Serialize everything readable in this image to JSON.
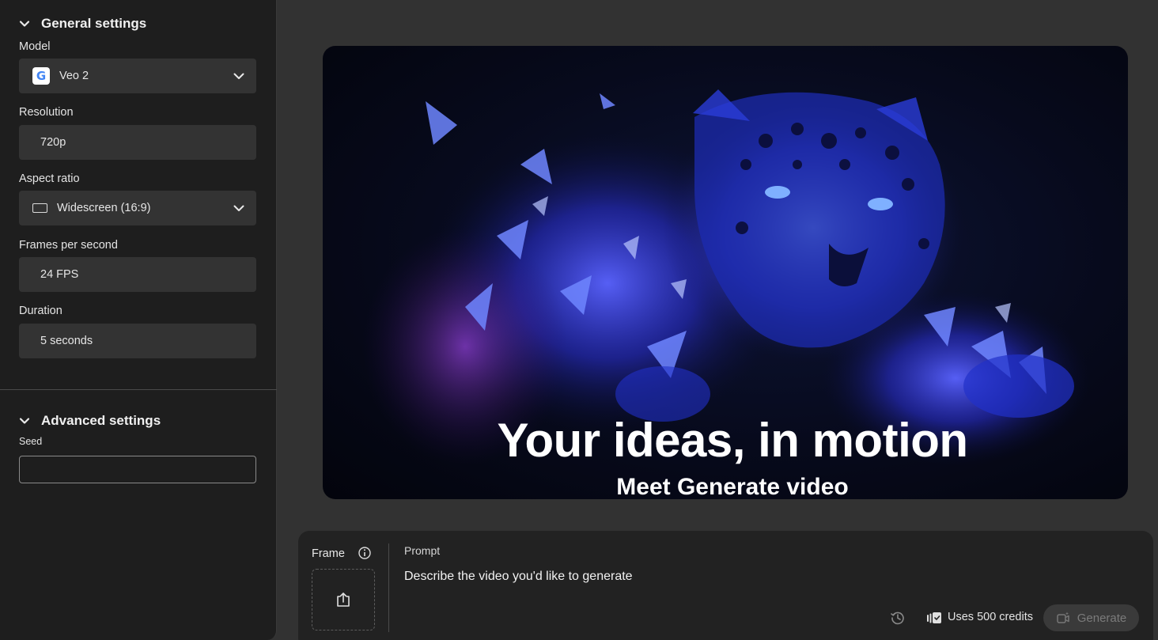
{
  "sidebar": {
    "general_heading": "General settings",
    "model": {
      "label": "Model",
      "value": "Veo 2",
      "logo_letter": "G",
      "icon": "google-logo-icon"
    },
    "resolution": {
      "label": "Resolution",
      "value": "720p"
    },
    "aspect_ratio": {
      "label": "Aspect ratio",
      "value": "Widescreen (16:9)",
      "icon": "widescreen-icon"
    },
    "fps": {
      "label": "Frames per second",
      "value": "24 FPS"
    },
    "duration": {
      "label": "Duration",
      "value": "5 seconds"
    },
    "advanced_heading": "Advanced settings",
    "seed": {
      "label": "Seed",
      "value": ""
    }
  },
  "hero": {
    "title": "Your ideas, in motion",
    "subtitle": "Meet Generate video",
    "image": "glowing blue crystalline jaguar leaping"
  },
  "prompt_panel": {
    "frame_label": "Frame",
    "prompt_label": "Prompt",
    "prompt_placeholder": "Describe the video you'd like to generate",
    "credits_text": "Uses 500 credits",
    "generate_label": "Generate"
  },
  "colors": {
    "page_bg": "#323232",
    "sidebar_bg": "#1e1e1e",
    "field_bg": "#333333",
    "panel_bg": "#222222",
    "hero_glow": "#3b3bff"
  }
}
